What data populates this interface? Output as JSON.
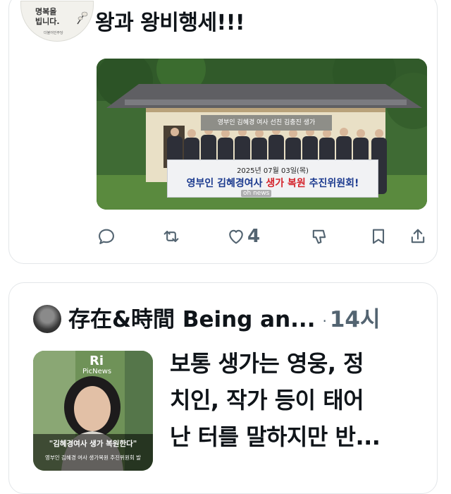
{
  "post1": {
    "avatar_lines": [
      "명복을",
      "빕니다."
    ],
    "avatar_small": "더불어민주당",
    "text": "왕과 왕비행세!!!",
    "image": {
      "wall_sign": "영부인 김혜경 여사 선친 김충진 생가",
      "banner_date": "2025년 07월 03일(목)",
      "banner_main_a": "영부인 김혜경여사 ",
      "banner_main_red": "생가 복원",
      "banner_main_b": " 추진위원회!",
      "watermark": "oh news"
    },
    "actions": {
      "reply_icon": "reply-icon",
      "repost_icon": "repost-icon",
      "like_icon": "heart-icon",
      "like_count": "4",
      "grok_icon": "grok-icon",
      "bookmark_icon": "bookmark-icon",
      "share_icon": "share-icon"
    }
  },
  "post2": {
    "author": "存在&時間 Being an...",
    "separator": "·",
    "time": "14시",
    "thumb": {
      "logo_mark": "Ri",
      "logo_text": "PicNews",
      "caption": "\"김혜경여사 생가 복원한다\"",
      "sub_caption": "영부인 김혜경 여사 생가복원 추진위원회 발"
    },
    "text_lines": [
      "보통 생가는 영웅, 정",
      "치인, 작가 등이 태어",
      "난 터를 말하지만 반..."
    ]
  },
  "colors": {
    "text": "#0f1419",
    "muted": "#536471",
    "border": "#e3e6e9",
    "banner_blue": "#1d3b8f",
    "banner_red": "#d4232b"
  }
}
